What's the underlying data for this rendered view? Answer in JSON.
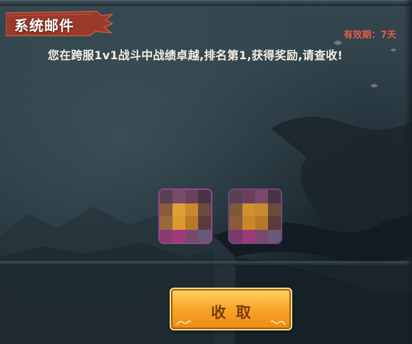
{
  "window": {
    "title": "系统邮件",
    "expire_text": "有效期：7天"
  },
  "mail": {
    "message": "您在跨服1v1战斗中战绩卓越,排名第1,获得奖励,请查收!"
  },
  "rewards": [
    {
      "icon": "pixelated-item-icon",
      "colors": [
        "#5a3f55",
        "#7a4a6a",
        "#6b3f5e",
        "#4a3346",
        "#8a5a3a",
        "#e0a038",
        "#c8892f",
        "#6a4a3a",
        "#9a6a3a",
        "#d99a30",
        "#b8782a",
        "#5a3a3a",
        "#8a3a70",
        "#a03a80",
        "#7a4a6a",
        "#6a5a7a"
      ]
    },
    {
      "icon": "pixelated-item-icon",
      "colors": [
        "#5a3f55",
        "#6a3f5e",
        "#7a4a6a",
        "#4a3346",
        "#7a5a3a",
        "#d09030",
        "#c88a2f",
        "#6a4a3a",
        "#8a5a3a",
        "#c8882a",
        "#b8782a",
        "#5a3a3a",
        "#7a3a6a",
        "#9a3a7a",
        "#7a4a6a",
        "#6a5a7a"
      ]
    }
  ],
  "actions": {
    "claim_label": "收取"
  },
  "colors": {
    "banner": "#9a3a2a",
    "expire": "#e85a4a",
    "button": "#f7a92d",
    "slot_border": "#8a4b8c"
  }
}
